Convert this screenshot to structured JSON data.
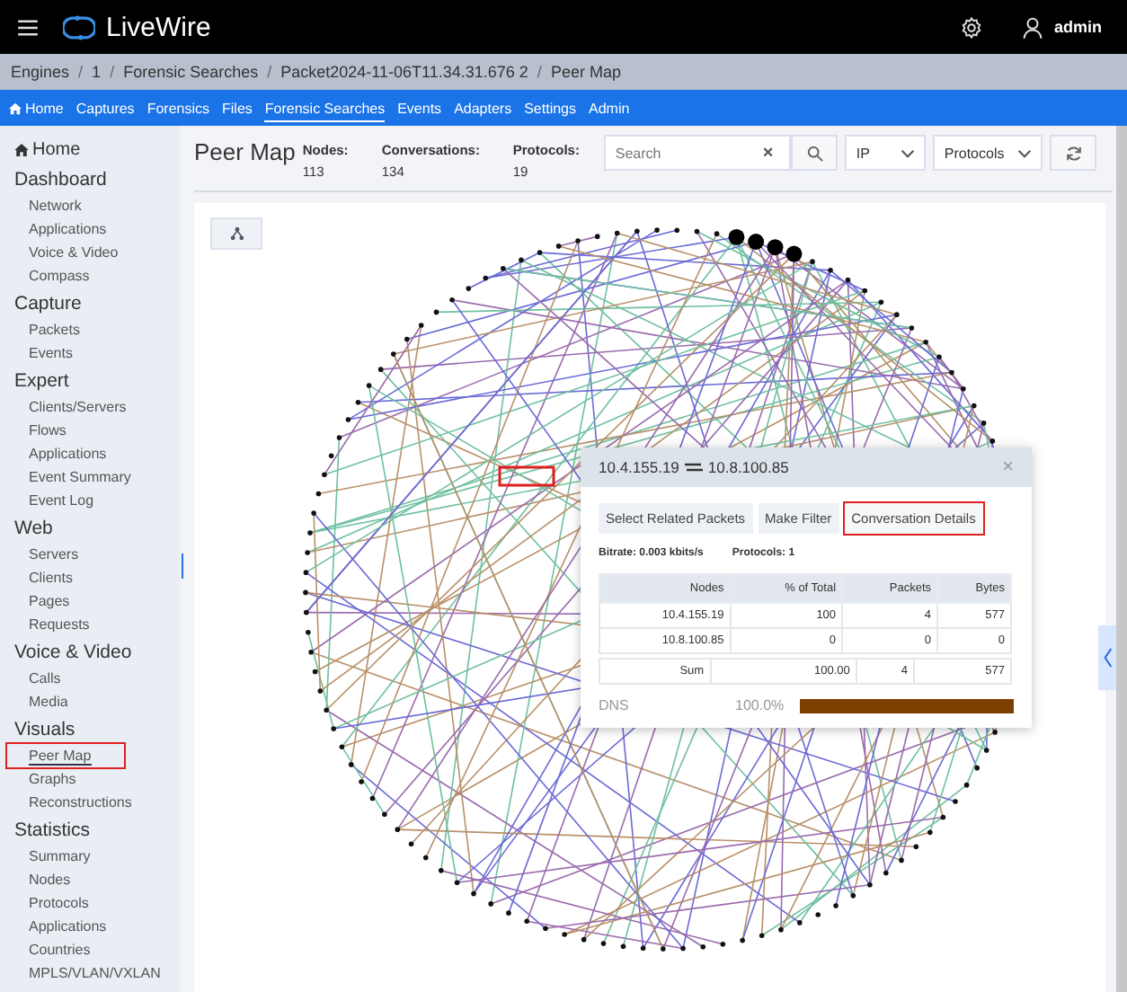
{
  "app": {
    "title": "LiveWire",
    "user": "admin"
  },
  "breadcrumb_separator": "/",
  "breadcrumb": [
    "Engines",
    "1",
    "Forensic Searches",
    "Packet2024-11-06T11.34.31.676 2",
    "Peer Map"
  ],
  "nav": [
    {
      "label": "Home",
      "icon": true,
      "selected": false
    },
    {
      "label": "Captures",
      "selected": false
    },
    {
      "label": "Forensics",
      "selected": false
    },
    {
      "label": "Files",
      "selected": false
    },
    {
      "label": "Forensic Searches",
      "selected": true
    },
    {
      "label": "Events",
      "selected": false
    },
    {
      "label": "Adapters",
      "selected": false
    },
    {
      "label": "Settings",
      "selected": false
    },
    {
      "label": "Admin",
      "selected": false
    }
  ],
  "sidebar": {
    "home": "Home",
    "sections": [
      {
        "title": "Dashboard",
        "items": [
          {
            "label": "Network",
            "selected": false
          },
          {
            "label": "Applications",
            "selected": false
          },
          {
            "label": "Voice & Video",
            "selected": false
          },
          {
            "label": "Compass",
            "selected": false
          }
        ]
      },
      {
        "title": "Capture",
        "items": [
          {
            "label": "Packets",
            "selected": false
          },
          {
            "label": "Events",
            "selected": false
          }
        ]
      },
      {
        "title": "Expert",
        "items": [
          {
            "label": "Clients/Servers",
            "selected": false
          },
          {
            "label": "Flows",
            "selected": false
          },
          {
            "label": "Applications",
            "selected": false
          },
          {
            "label": "Event Summary",
            "selected": false
          },
          {
            "label": "Event Log",
            "selected": false
          }
        ]
      },
      {
        "title": "Web",
        "items": [
          {
            "label": "Servers",
            "selected": false
          },
          {
            "label": "Clients",
            "selected": false
          },
          {
            "label": "Pages",
            "selected": false
          },
          {
            "label": "Requests",
            "selected": false
          }
        ]
      },
      {
        "title": "Voice & Video",
        "items": [
          {
            "label": "Calls",
            "selected": false
          },
          {
            "label": "Media",
            "selected": false
          }
        ]
      },
      {
        "title": "Visuals",
        "items": [
          {
            "label": "Peer Map",
            "selected": true,
            "highlighted": true
          },
          {
            "label": "Graphs",
            "selected": false
          },
          {
            "label": "Reconstructions",
            "selected": false
          }
        ]
      },
      {
        "title": "Statistics",
        "items": [
          {
            "label": "Summary",
            "selected": false
          },
          {
            "label": "Nodes",
            "selected": false
          },
          {
            "label": "Protocols",
            "selected": false
          },
          {
            "label": "Applications",
            "selected": false
          },
          {
            "label": "Countries",
            "selected": false
          },
          {
            "label": "MPLS/VLAN/VXLAN",
            "selected": false
          }
        ]
      }
    ]
  },
  "page": {
    "title": "Peer Map",
    "stats": [
      {
        "label": "Nodes:",
        "value": "113"
      },
      {
        "label": "Conversations:",
        "value": "134"
      },
      {
        "label": "Protocols:",
        "value": "19"
      }
    ],
    "search": {
      "placeholder": "Search",
      "clear": "×"
    },
    "selects": [
      "IP",
      "Protocols"
    ]
  },
  "popover": {
    "title_a": "10.4.155.19",
    "title_b": "10.8.100.85",
    "close": "×",
    "buttons": [
      {
        "label": "Select Related Packets",
        "highlighted": false
      },
      {
        "label": "Make Filter",
        "highlighted": false
      },
      {
        "label": "Conversation Details",
        "highlighted": true
      }
    ],
    "bitrate": "Bitrate: 0.003 kbits/s",
    "protocols": "Protocols: 1",
    "columns": [
      "Nodes",
      "% of Total",
      "Packets",
      "Bytes"
    ],
    "rows": [
      [
        "10.4.155.19",
        "100",
        "4",
        "577"
      ],
      [
        "10.8.100.85",
        "0",
        "0",
        "0"
      ]
    ],
    "sum": [
      "Sum",
      "100.00",
      "4",
      "577"
    ],
    "protocol_bars": [
      {
        "name": "DNS",
        "percent": "100.0%",
        "level": 1.0,
        "color": "#7b3f00"
      }
    ]
  }
}
